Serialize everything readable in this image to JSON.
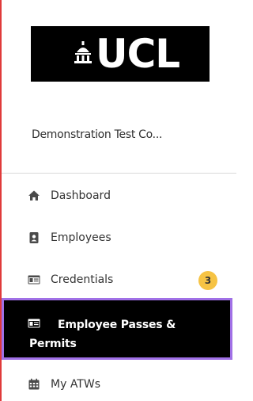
{
  "brand": {
    "logo_text": "UCL"
  },
  "company": {
    "name": "Demonstration Test Co..."
  },
  "nav": {
    "items": [
      {
        "label": "Dashboard",
        "icon": "home-icon"
      },
      {
        "label": "Employees",
        "icon": "id-badge-icon"
      },
      {
        "label": "Credentials",
        "icon": "id-card-icon",
        "badge": "3"
      },
      {
        "label": "Employee Passes & Permits",
        "icon": "id-card-icon",
        "active": true
      },
      {
        "label": "My ATWs",
        "icon": "calendar-icon"
      }
    ]
  },
  "colors": {
    "active_bg": "#000000",
    "active_border": "#a070e6",
    "badge_bg": "#f6c344",
    "left_rule": "#e03a3a"
  }
}
